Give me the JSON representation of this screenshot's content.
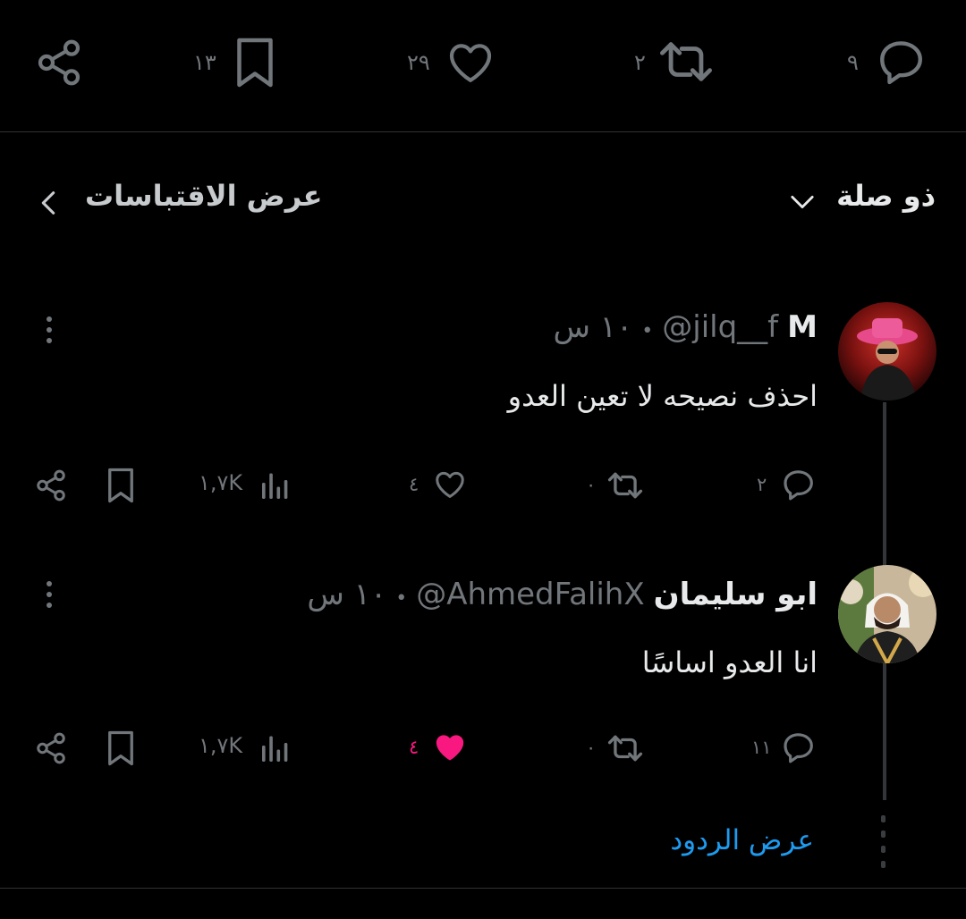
{
  "main_actions": {
    "reply_count": "٩",
    "retweet_count": "٢",
    "like_count": "٢٩",
    "bookmark_count": "١٣"
  },
  "sort": {
    "label": "ذو صلة"
  },
  "quotes": {
    "label": "عرض الاقتباسات"
  },
  "replies": [
    {
      "display_name": "M",
      "handle": "@jilq__f",
      "separator": "•",
      "time": "١٠ س",
      "text": "احذف نصيحه لا تعين العدو",
      "reply_count": "٢",
      "retweet_count": "٠",
      "like_count": "٤",
      "views": "١,٧K",
      "liked": false
    },
    {
      "display_name": "ابو سليمان",
      "handle": "@AhmedFalihX",
      "separator": "•",
      "time": "١٠ س",
      "text": "انا العدو اساسًا",
      "reply_count": "١١",
      "retweet_count": "٠",
      "like_count": "٤",
      "views": "١,٧K",
      "liked": true
    }
  ],
  "show_replies": {
    "label": "عرض الردود"
  },
  "colors": {
    "background": "#000000",
    "text": "#e7e9ea",
    "muted": "#71767b",
    "link": "#1d9bf0",
    "like_active": "#f91880",
    "divider": "#2f3336"
  }
}
